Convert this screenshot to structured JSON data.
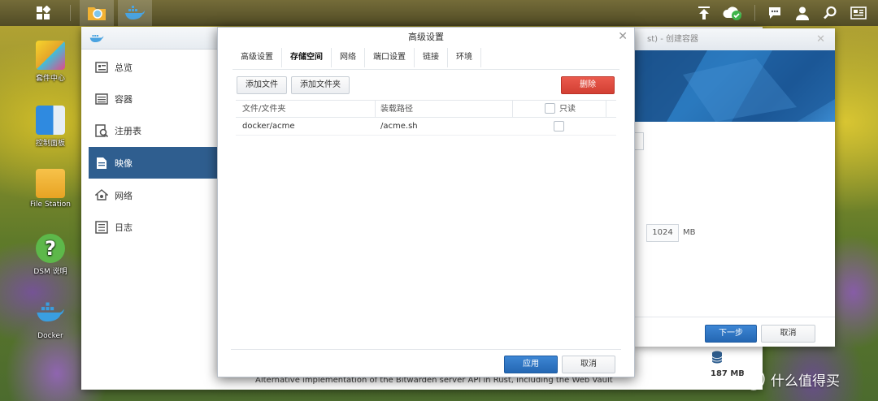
{
  "taskbar": {
    "icons": [
      "apps-grid-icon",
      "file-station-icon",
      "docker-icon",
      "upload-icon",
      "cloud-sync-icon",
      "chat-icon",
      "user-icon",
      "search-icon",
      "widgets-icon"
    ]
  },
  "desktop": {
    "icons": [
      {
        "label": "套件中心",
        "icon": "package-center-icon"
      },
      {
        "label": "控制面板",
        "icon": "control-panel-icon"
      },
      {
        "label": "File Station",
        "icon": "file-station-icon"
      },
      {
        "label": "DSM 说明",
        "icon": "help-icon"
      },
      {
        "label": "Docker",
        "icon": "docker-icon"
      }
    ]
  },
  "docker_window": {
    "sidebar": [
      {
        "label": "总览",
        "icon": "overview-icon"
      },
      {
        "label": "容器",
        "icon": "container-icon"
      },
      {
        "label": "注册表",
        "icon": "registry-icon"
      },
      {
        "label": "映像",
        "icon": "image-icon"
      },
      {
        "label": "网络",
        "icon": "network-icon"
      },
      {
        "label": "日志",
        "icon": "log-icon"
      }
    ],
    "active_item": "映像",
    "description": "Alternative implementation of the Bitwarden server API in Rust, including the Web Vault.",
    "image_size": "187 MB"
  },
  "wizard": {
    "title_fragment": "st) - 创建容器",
    "memory_value": "1024",
    "memory_unit": "MB",
    "next_label": "下一步",
    "cancel_label": "取消"
  },
  "dialog": {
    "title": "高级设置",
    "tabs": [
      "高级设置",
      "存储空间",
      "网络",
      "端口设置",
      "链接",
      "环境"
    ],
    "active_tab": "存储空间",
    "add_file_label": "添加文件",
    "add_folder_label": "添加文件夹",
    "delete_label": "删除",
    "columns": [
      "文件/文件夹",
      "装载路径",
      "只读"
    ],
    "rows": [
      {
        "path": "docker/acme",
        "mount": "/acme.sh",
        "readonly": false
      }
    ],
    "apply_label": "应用",
    "cancel_label": "取消"
  },
  "watermark": "什么值得买",
  "colors": {
    "accent": "#2f5e8f",
    "primary_button": "#2467b3",
    "danger_button": "#d23f33"
  }
}
